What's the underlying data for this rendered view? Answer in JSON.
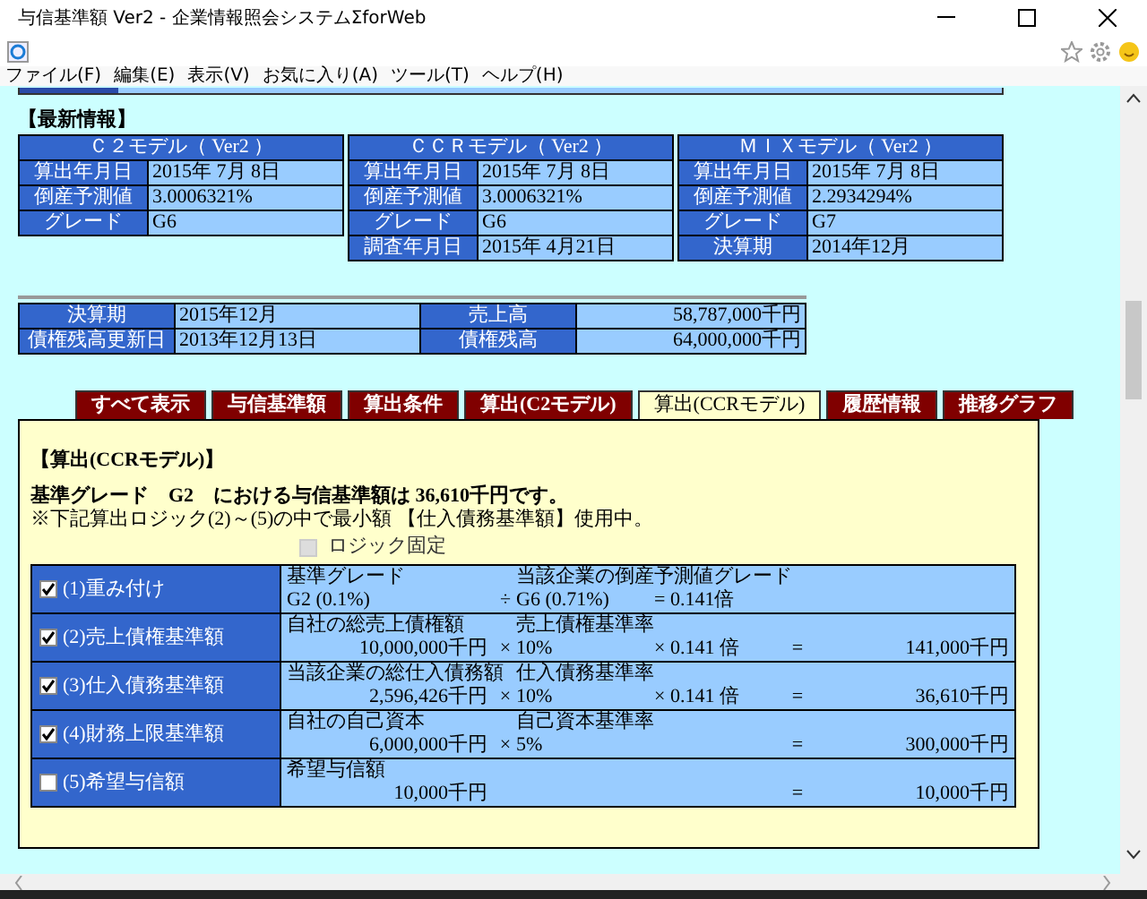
{
  "window": {
    "title": "与信基準額 Ver2 - 企業情報照会システムΣforWeb"
  },
  "menu": [
    "ファイル(F)",
    "編集(E)",
    "表示(V)",
    "お気に入り(A)",
    "ツール(T)",
    "ヘルプ(H)"
  ],
  "latest": {
    "heading": "【最新情報】",
    "models": [
      {
        "title": "Ｃ２モデル（ Ver2 ）",
        "rows": [
          {
            "label": "算出年月日",
            "value": "2015年 7月 8日"
          },
          {
            "label": "倒産予測値",
            "value": "3.0006321%"
          },
          {
            "label": "グレード",
            "value": "G6"
          }
        ]
      },
      {
        "title": "ＣＣＲモデル（ Ver2 ）",
        "rows": [
          {
            "label": "算出年月日",
            "value": "2015年 7月 8日"
          },
          {
            "label": "倒産予測値",
            "value": "3.0006321%"
          },
          {
            "label": "グレード",
            "value": "G6"
          },
          {
            "label": "調査年月日",
            "value": "2015年 4月21日"
          }
        ]
      },
      {
        "title": "ＭＩＸモデル（ Ver2 ）",
        "rows": [
          {
            "label": "算出年月日",
            "value": "2015年 7月 8日"
          },
          {
            "label": "倒産予測値",
            "value": "2.2934294%"
          },
          {
            "label": "グレード",
            "value": "G7"
          },
          {
            "label": "決算期",
            "value": "2014年12月"
          }
        ]
      }
    ]
  },
  "summary": [
    [
      {
        "label": "決算期",
        "value": "2015年12月",
        "kind": "date"
      },
      {
        "label": "売上高",
        "value": "58,787,000千円",
        "kind": "amount"
      }
    ],
    [
      {
        "label": "債権残高更新日",
        "value": "2013年12月13日",
        "kind": "date"
      },
      {
        "label": "債権残高",
        "value": "64,000,000千円",
        "kind": "amount"
      }
    ]
  ],
  "tabs": [
    {
      "label": "すべて表示",
      "selected": false
    },
    {
      "label": "与信基準額",
      "selected": false
    },
    {
      "label": "算出条件",
      "selected": false
    },
    {
      "label": "算出(C2モデル)",
      "selected": false
    },
    {
      "label": "算出(CCRモデル)",
      "selected": true
    },
    {
      "label": "履歴情報",
      "selected": false
    },
    {
      "label": "推移グラフ",
      "selected": false
    }
  ],
  "panel": {
    "heading": "【算出(CCRモデル)】",
    "result": "基準グレード　G2　における与信基準額は 36,610千円です。",
    "note": "※下記算出ロジック(2)～(5)の中で最小額 【仕入債務基準額】使用中。",
    "lock": {
      "label": "ロジック固定",
      "checked": false,
      "disabled": true
    },
    "rows": [
      {
        "label": "(1)重み付け",
        "checked": true,
        "kind": "ratio",
        "head": [
          "基準グレード",
          "当該企業の倒産予測値グレード"
        ],
        "amount": "G2 (0.1%)",
        "op": "÷",
        "rate": "G6 (0.71%)",
        "factor": "= 0.141倍"
      },
      {
        "label": "(2)売上債権基準額",
        "checked": true,
        "kind": "amount",
        "head": [
          "自社の総売上債権額",
          "売上債権基準率"
        ],
        "amount": "10,000,000千円",
        "op": "×",
        "rate": "10%",
        "factor": "× 0.141 倍",
        "eq": "=",
        "result": "141,000千円"
      },
      {
        "label": "(3)仕入債務基準額",
        "checked": true,
        "kind": "amount",
        "head": [
          "当該企業の総仕入債務額",
          "仕入債務基準率"
        ],
        "amount": "2,596,426千円",
        "op": "×",
        "rate": "10%",
        "factor": "× 0.141 倍",
        "eq": "=",
        "result": "36,610千円"
      },
      {
        "label": "(4)財務上限基準額",
        "checked": true,
        "kind": "amount",
        "head": [
          "自社の自己資本",
          "自己資本基準率"
        ],
        "amount": "6,000,000千円",
        "op": "×",
        "rate": "5%",
        "eq": "=",
        "result": "300,000千円"
      },
      {
        "label": "(5)希望与信額",
        "checked": false,
        "kind": "amount",
        "head": [
          "希望与信額"
        ],
        "amount": "10,000千円",
        "eq": "=",
        "result": "10,000千円"
      }
    ]
  }
}
